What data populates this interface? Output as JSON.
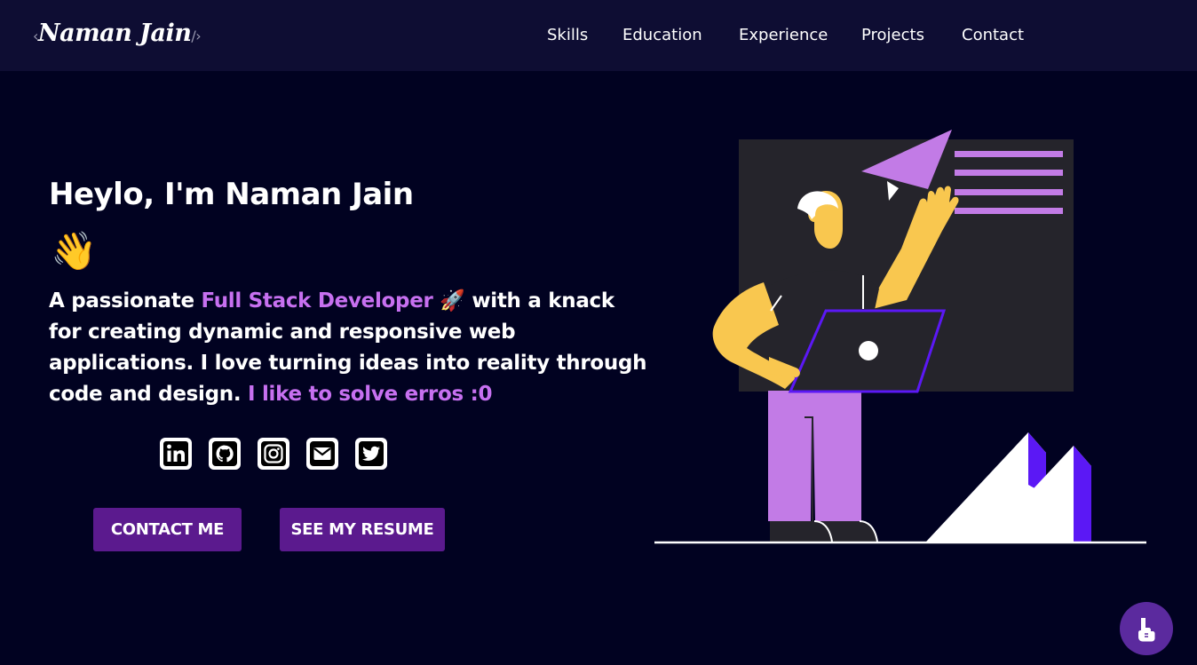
{
  "header": {
    "logo_open": "‹",
    "logo_name": "Naman Jain",
    "logo_close": "/›",
    "nav": [
      "Skills",
      "Education",
      "Experience",
      "Projects",
      "Contact"
    ]
  },
  "hero": {
    "title": "Heylo, I'm Naman Jain",
    "wave": "👋",
    "desc": {
      "prefix": "A passionate ",
      "highlight": "Full Stack Developer",
      "rocket": "🚀",
      "middle": " with a knack for creating dynamic and responsive web applications. I love turning ideas into reality through code and design. ",
      "closing": "I like to solve erros :0"
    },
    "socials": [
      "linkedin-icon",
      "github-icon",
      "instagram-icon",
      "mail-icon",
      "twitter-icon"
    ],
    "buttons": {
      "contact": "CONTACT ME",
      "resume": "SEE MY RESUME"
    }
  },
  "colors": {
    "background": "#010221",
    "navbar": "#0e0d33",
    "accent": "#c770f0",
    "button": "#5b1a8e"
  }
}
